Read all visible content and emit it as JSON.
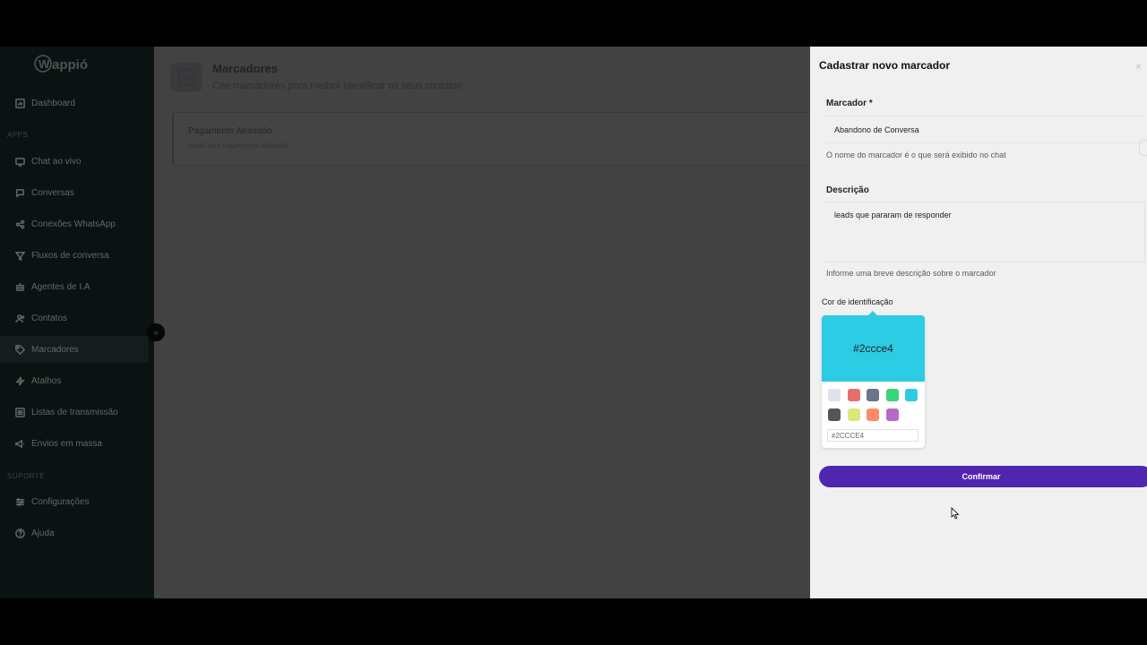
{
  "sidebar": {
    "logo_text": "Wappió",
    "items": [
      {
        "label": "Dashboard",
        "icon": "dashboard-icon"
      },
      {
        "label": "Chat ao vivo",
        "icon": "monitor-icon"
      },
      {
        "label": "Conversas",
        "icon": "chat-icon"
      },
      {
        "label": "Conexões WhatsApp",
        "icon": "connections-icon"
      },
      {
        "label": "Fluxos de conversa",
        "icon": "filter-icon"
      },
      {
        "label": "Agentes de I.A",
        "icon": "robot-icon"
      },
      {
        "label": "Contatos",
        "icon": "contacts-icon"
      },
      {
        "label": "Marcadores",
        "icon": "tag-icon"
      },
      {
        "label": "Atalhos",
        "icon": "bolt-icon"
      },
      {
        "label": "Listas de transmissão",
        "icon": "list-icon"
      },
      {
        "label": "Envios em massa",
        "icon": "megaphone-icon"
      },
      {
        "label": "Configurações",
        "icon": "settings-icon"
      },
      {
        "label": "Ajuda",
        "icon": "help-icon"
      }
    ],
    "sections": {
      "apps": "APPS",
      "suporte": "SUPORTE"
    },
    "collapse_glyph": "«"
  },
  "main": {
    "icon_glyph": "</>",
    "title": "Marcadores",
    "subtitle": "Crie marcadores para melhor identificar os seus contatos",
    "tags": [
      {
        "name": "Pagamento Atrasado",
        "description": "leads com pagamento atrasado"
      }
    ]
  },
  "drawer": {
    "title": "Cadastrar novo marcador",
    "close_glyph": "×",
    "marker_label": "Marcador *",
    "marker_value": "Abandono de Conversa",
    "marker_hint": "O nome do marcador é o que será exibido no chat",
    "description_label": "Descrição",
    "description_value": "leads que pararam de responder",
    "description_hint": "Informe uma breve descrição sobre o marcador",
    "color_label": "Cor de identificação",
    "selected_color": "#2ccce4",
    "hex_value": "#2CCCE4",
    "swatches": [
      "#dce3ea",
      "#e76f6a",
      "#697689",
      "#37d67a",
      "#2ccce4",
      "#555555",
      "#dce775",
      "#ff8a65",
      "#ba68c8"
    ],
    "confirm_label": "Confirmar"
  },
  "colors": {
    "accent": "#5026b0",
    "sidebar_bg": "#0b1312",
    "overlay_bg": "#424242"
  }
}
